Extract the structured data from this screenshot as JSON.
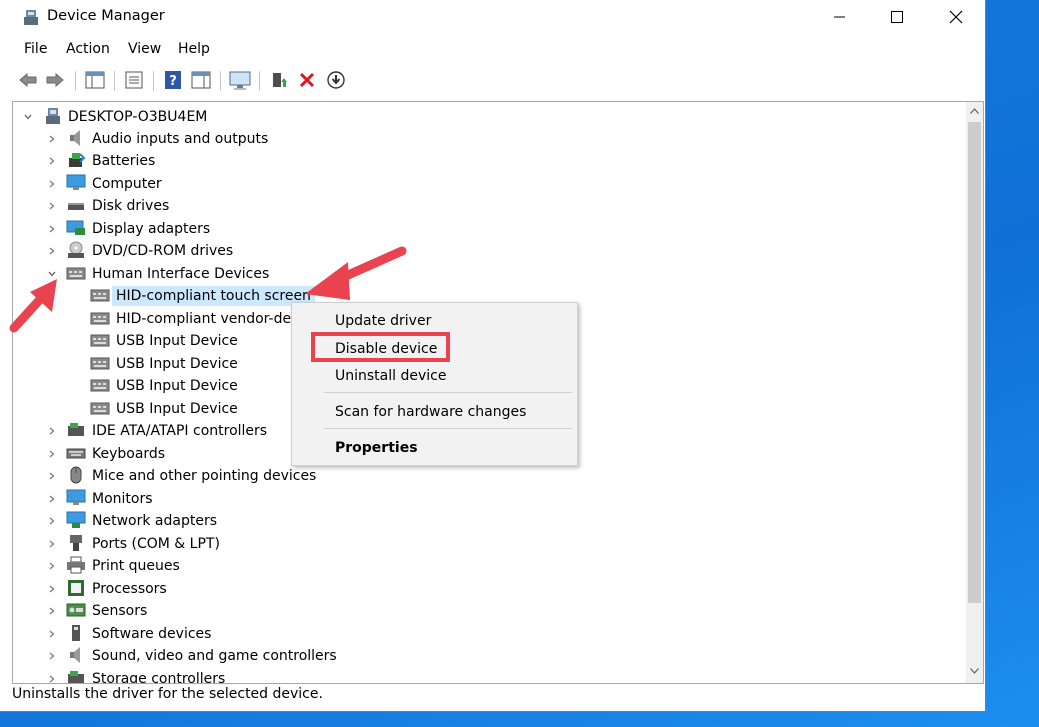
{
  "window": {
    "title": "Device Manager",
    "controls": {
      "minimize": "—",
      "maximize": "☐",
      "close": "✕"
    }
  },
  "menubar": [
    "File",
    "Action",
    "View",
    "Help"
  ],
  "toolbar": {
    "icons": [
      "back-icon",
      "forward-icon",
      "properties-pane-icon",
      "device-list-icon",
      "help-icon",
      "action-pane-icon",
      "monitor-icon",
      "update-driver-icon",
      "uninstall-icon",
      "download-icon"
    ]
  },
  "tree": {
    "root": "DESKTOP-O3BU4EM",
    "categories": [
      {
        "label": "Audio inputs and outputs"
      },
      {
        "label": "Batteries"
      },
      {
        "label": "Computer"
      },
      {
        "label": "Disk drives"
      },
      {
        "label": "Display adapters"
      },
      {
        "label": "DVD/CD-ROM drives"
      },
      {
        "label": "Human Interface Devices",
        "expanded": true
      }
    ],
    "hid_children": [
      {
        "label": "HID-compliant touch screen",
        "selected": true
      },
      {
        "label": "HID-compliant vendor-defi"
      },
      {
        "label": "USB Input Device"
      },
      {
        "label": "USB Input Device"
      },
      {
        "label": "USB Input Device"
      },
      {
        "label": "USB Input Device"
      }
    ],
    "more_categories": [
      {
        "label": "IDE ATA/ATAPI controllers"
      },
      {
        "label": "Keyboards"
      },
      {
        "label": "Mice and other pointing devices"
      },
      {
        "label": "Monitors"
      },
      {
        "label": "Network adapters"
      },
      {
        "label": "Ports (COM & LPT)"
      },
      {
        "label": "Print queues"
      },
      {
        "label": "Processors"
      },
      {
        "label": "Sensors"
      },
      {
        "label": "Software devices"
      },
      {
        "label": "Sound, video and game controllers"
      },
      {
        "label": "Storage controllers"
      }
    ]
  },
  "context_menu": {
    "update_driver": "Update driver",
    "disable_device": "Disable device",
    "uninstall_device": "Uninstall device",
    "scan": "Scan for hardware changes",
    "properties": "Properties"
  },
  "statusbar": "Uninstalls the driver for the selected device.",
  "colors": {
    "accent": "#e8434e",
    "selection": "#cce8ff",
    "desktop": "#1a7fe0"
  }
}
